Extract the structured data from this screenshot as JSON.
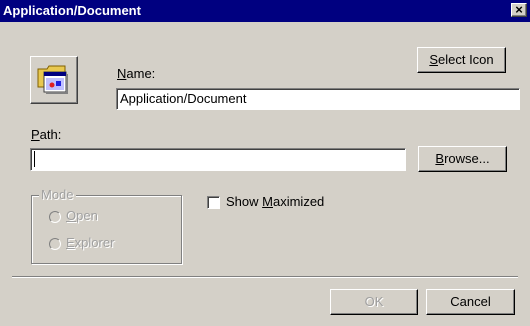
{
  "window": {
    "title": "Application/Document",
    "close_glyph": "×"
  },
  "icon": {
    "name": "application-document-icon"
  },
  "select_icon_button": {
    "label_pre": "",
    "label_key": "S",
    "label_post": "elect Icon"
  },
  "name_field": {
    "label_key": "N",
    "label_post": "ame:",
    "value": "Application/Document"
  },
  "path_field": {
    "label_key": "P",
    "label_post": "ath:",
    "value": ""
  },
  "browse_button": {
    "label_key": "B",
    "label_post": "rowse..."
  },
  "mode_group": {
    "legend": "Mode",
    "options": [
      {
        "key": "O",
        "post": "pen"
      },
      {
        "key": "E",
        "post": "xplorer"
      }
    ]
  },
  "show_maximized": {
    "pre": "Show ",
    "key": "M",
    "post": "aximized",
    "checked": false
  },
  "ok_button": {
    "label": "OK"
  },
  "cancel_button": {
    "label": "Cancel"
  }
}
